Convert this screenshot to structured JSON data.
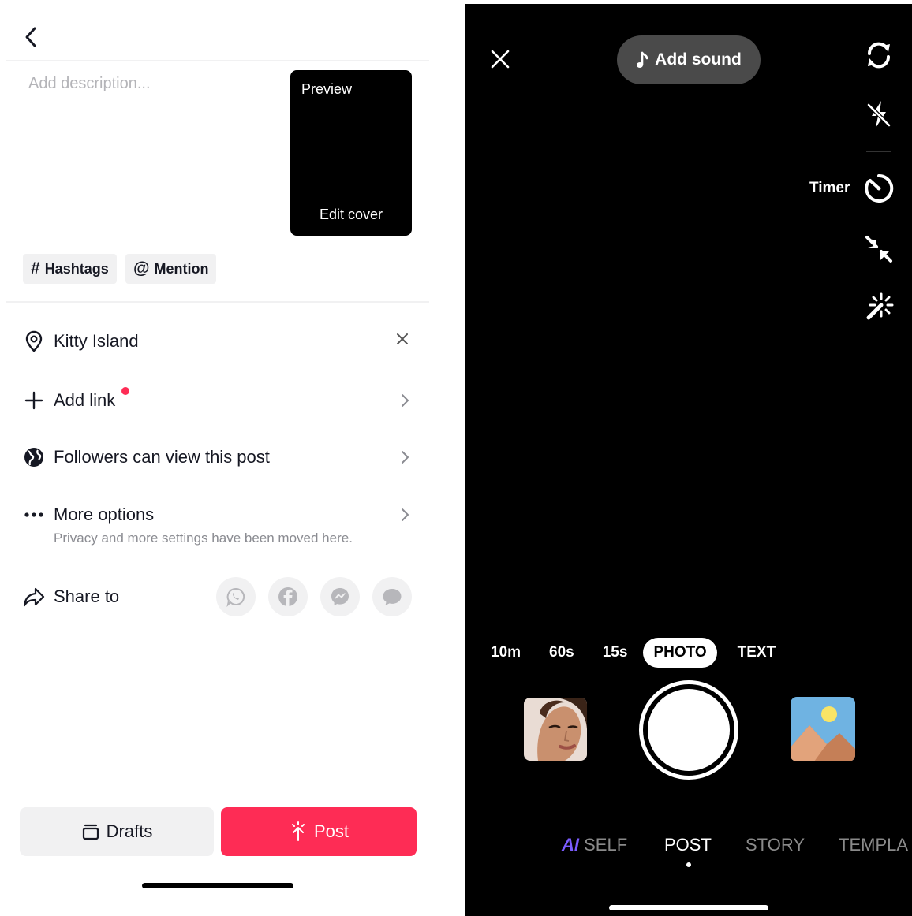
{
  "left": {
    "description": {
      "placeholder": "Add description..."
    },
    "preview": {
      "label": "Preview",
      "edit_cover": "Edit cover"
    },
    "chips": [
      {
        "symbol": "#",
        "label": "Hashtags"
      },
      {
        "symbol": "@",
        "label": "Mention"
      }
    ],
    "location": {
      "label": "Kitty Island",
      "icon": "location-pin-icon"
    },
    "add_link": {
      "label": "Add link",
      "badge_color": "#fe2c55"
    },
    "visibility": {
      "label": "Followers can view this post",
      "icon": "globe-icon"
    },
    "more_options": {
      "label": "More options",
      "subtitle": "Privacy and more settings have been moved here."
    },
    "share": {
      "label": "Share to",
      "targets": [
        "whatsapp-icon",
        "facebook-icon",
        "messenger-icon",
        "message-icon"
      ]
    },
    "buttons": {
      "drafts": "Drafts",
      "post": "Post"
    },
    "colors": {
      "accent": "#fe2c55",
      "chip_bg": "#f1f1f2",
      "muted_text": "#8a8b91"
    }
  },
  "right": {
    "add_sound": "Add sound",
    "side_controls": [
      "flip-camera-icon",
      "flash-off-icon",
      "timer-icon",
      "collapse-icon",
      "magic-wand-icon"
    ],
    "timer_label": "Timer",
    "capture_modes": [
      "10m",
      "60s",
      "15s",
      "PHOTO",
      "TEXT"
    ],
    "active_capture_mode": "PHOTO",
    "bottom_tabs": {
      "ai_prefix": "AI",
      "ai_self": "SELF",
      "post": "POST",
      "story": "STORY",
      "templates": "TEMPLA"
    },
    "active_bottom_tab": "POST",
    "colors": {
      "background": "#000000",
      "ai_accent": "#7b5cff",
      "inactive_tab": "#8a8a8a"
    }
  }
}
